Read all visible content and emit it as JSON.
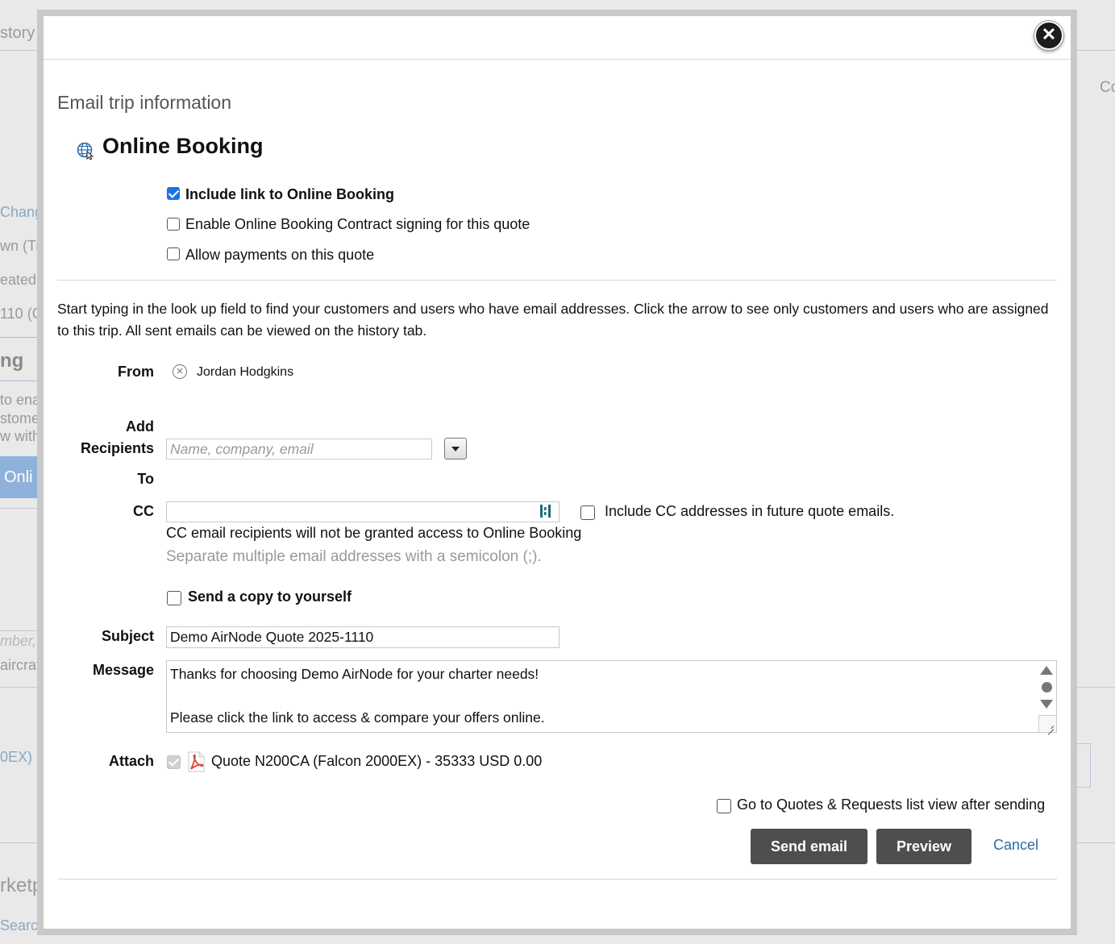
{
  "background": {
    "fragments": {
      "history_tab": "story",
      "copy": "Co",
      "change": "Chang",
      "down": "wn (Tri",
      "created": "eated",
      "quote_no": "110 (C",
      "heading": "ng",
      "to_enable": "to ena",
      "customer": "stome",
      "view_with": "w with",
      "online_btn": "Onli",
      "search_ph": "mber, t",
      "aircraft": "aircraf",
      "aircraft_ex": "0EX)",
      "market": "rketp",
      "search": "Searc"
    }
  },
  "dialog": {
    "title": "Email trip information",
    "section_title": "Online Booking",
    "options": {
      "include_link": {
        "label": "Include link to Online Booking",
        "checked": true
      },
      "enable_contract": {
        "label": "Enable Online Booking Contract signing for this quote",
        "checked": false
      },
      "allow_payments": {
        "label": "Allow payments on this quote",
        "checked": false
      }
    },
    "intro_text": "Start typing in the look up field to find your customers and users who have email addresses. Click the arrow to see only customers and users who are assigned to this trip. All sent emails can be viewed on the history tab.",
    "from": {
      "label": "From",
      "value": "Jordan Hodgkins"
    },
    "add_recipients": {
      "label_line1": "Add",
      "label_line2": "Recipients",
      "placeholder": "Name, company, email",
      "value": ""
    },
    "to": {
      "label": "To"
    },
    "cc": {
      "label": "CC",
      "value": "",
      "include_future_label": "Include CC addresses in future quote emails.",
      "note": "CC email recipients will not be granted access to Online Booking",
      "hint": "Separate multiple email addresses with a semicolon (;)."
    },
    "send_copy": {
      "label": "Send a copy to yourself",
      "checked": false
    },
    "subject": {
      "label": "Subject",
      "value": "Demo AirNode Quote 2025-1110"
    },
    "message": {
      "label": "Message",
      "lines": [
        "Thanks for choosing Demo AirNode for your charter needs!",
        "",
        "Please click the link to access & compare your offers online."
      ]
    },
    "attach": {
      "label": "Attach",
      "file": "Quote N200CA (Falcon 2000EX) - 35333 USD 0.00",
      "checked": true
    },
    "go_to_list": {
      "label": "Go to Quotes & Requests list view after sending",
      "checked": false
    },
    "buttons": {
      "send": "Send email",
      "preview": "Preview",
      "cancel": "Cancel"
    }
  },
  "colors": {
    "accent": "#1a73e8",
    "button": "#4e4e4e",
    "link": "#2b6ca8"
  }
}
